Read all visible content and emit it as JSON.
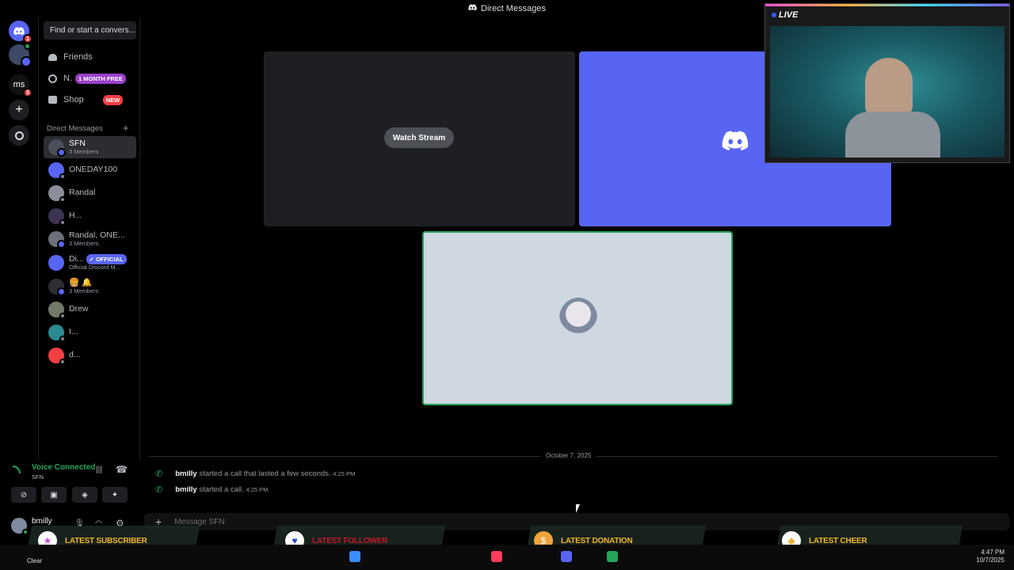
{
  "titlebar": {
    "title": "Direct Messages"
  },
  "servers": {
    "home_badge": "1",
    "ms_label": "ms",
    "ms_badge": "3"
  },
  "dmcol": {
    "search_placeholder": "Find or start a convers...",
    "nav": [
      {
        "label": "Friends"
      },
      {
        "label": "N.",
        "pill": "1 MONTH FREE"
      },
      {
        "label": "Shop",
        "pill": "NEW"
      }
    ],
    "dm_header": "Direct Messages",
    "dms": [
      {
        "name": "SFN",
        "sub": "3 Members"
      },
      {
        "name": "ONEDAY100",
        "sub": ""
      },
      {
        "name": "Randal",
        "sub": ""
      },
      {
        "name": "H...",
        "sub": ""
      },
      {
        "name": "Randal, ONE...",
        "sub": "3 Members"
      },
      {
        "name": "Di...",
        "sub": "Official Discord M...",
        "badge": "✓ OFFICIAL"
      },
      {
        "name": "🍔 🔔",
        "sub": "3 Members"
      },
      {
        "name": "Drew",
        "sub": ""
      },
      {
        "name": "I...",
        "sub": ""
      },
      {
        "name": "d...",
        "sub": ""
      }
    ]
  },
  "call": {
    "watch_label": "Watch Stream"
  },
  "webcam": {
    "live_label": "LIVE"
  },
  "chat": {
    "date": "October 7, 2025",
    "messages": [
      {
        "user": "bmilly",
        "text": "started a call that lasted a few seconds.",
        "time": "4:25 PM"
      },
      {
        "user": "bmilly",
        "text": "started a call.",
        "time": "4:25 PM"
      }
    ],
    "placeholder": "Message SFN"
  },
  "voice": {
    "status": "Voice Connected",
    "channel": "SFN",
    "user": "bmilly"
  },
  "alerts": [
    {
      "label": "LATEST SUBSCRIBER",
      "color": "#f0b429",
      "icon": "★"
    },
    {
      "label": "LATEST FOLLOWER",
      "color": "#c0182a",
      "icon": "♥"
    },
    {
      "label": "LATEST DONATION",
      "color": "#f0b429",
      "icon": "$"
    },
    {
      "label": "LATEST CHEER",
      "color": "#f0b429",
      "icon": "◆"
    }
  ],
  "taskbar": {
    "weather": "Clear",
    "time": "4:47 PM",
    "date": "10/7/2025"
  },
  "colors": {
    "blurple": "#5865f2",
    "green": "#23a55a",
    "red": "#f23f42"
  }
}
